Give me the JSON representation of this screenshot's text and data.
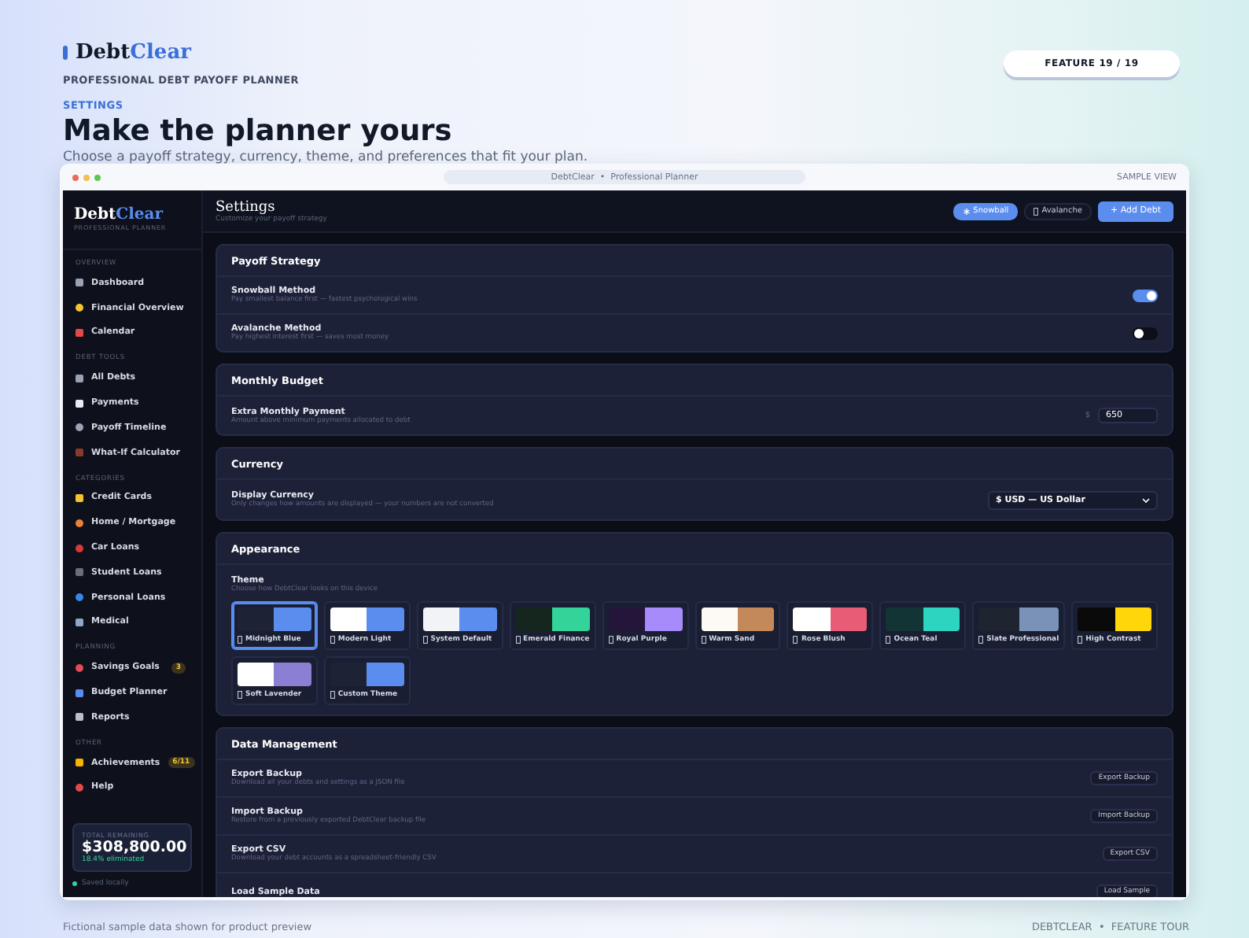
{
  "page": {
    "brand": {
      "name": "Debt",
      "accent": "Clear"
    },
    "tagline": "PROFESSIONAL DEBT PAYOFF PLANNER",
    "eyebrow": "SETTINGS",
    "heading": "Make the planner yours",
    "description": "Choose a payoff strategy, currency, theme, and preferences that fit your plan.",
    "feature_badge": "FEATURE 19 / 19",
    "footer_note": "Fictional sample data shown for product preview",
    "footer_right": "DEBTCLEAR  •  FEATURE TOUR"
  },
  "window": {
    "title": "DebtClear  •  Professional Planner",
    "label": "SAMPLE VIEW"
  },
  "sidebar": {
    "brand": {
      "name": "Debt",
      "accent": "Clear"
    },
    "subtitle": "PROFESSIONAL PLANNER",
    "sections": [
      {
        "title": "OVERVIEW",
        "items": [
          {
            "label": "Dashboard"
          },
          {
            "label": "Financial Overview"
          },
          {
            "label": "Calendar"
          }
        ]
      },
      {
        "title": "DEBT TOOLS",
        "items": [
          {
            "label": "All Debts"
          },
          {
            "label": "Payments"
          },
          {
            "label": "Payoff Timeline"
          },
          {
            "label": "What-If Calculator"
          }
        ]
      },
      {
        "title": "CATEGORIES",
        "items": [
          {
            "label": "Credit Cards"
          },
          {
            "label": "Home / Mortgage"
          },
          {
            "label": "Car Loans"
          },
          {
            "label": "Student Loans"
          },
          {
            "label": "Personal Loans"
          },
          {
            "label": "Medical"
          }
        ]
      },
      {
        "title": "PLANNING",
        "items": [
          {
            "label": "Savings Goals",
            "badge": "3"
          },
          {
            "label": "Budget Planner"
          },
          {
            "label": "Reports"
          }
        ]
      },
      {
        "title": "OTHER",
        "items": [
          {
            "label": "Achievements",
            "badge": "6/11"
          },
          {
            "label": "Help"
          }
        ]
      }
    ],
    "summary": {
      "label": "TOTAL REMAINING",
      "amount": "$308,800.00",
      "progress": "18.4% eliminated"
    },
    "status": "Saved locally"
  },
  "header": {
    "title": "Settings",
    "subtitle": "Customize your payoff strategy",
    "buttons": [
      {
        "label": "Snowball",
        "selected": true
      },
      {
        "label": "Avalanche",
        "selected": false
      }
    ],
    "primary_button": "+ Add Debt"
  },
  "sections": [
    {
      "title": "Payoff Strategy",
      "rows": [
        {
          "kind": "toggle",
          "label": "Snowball Method",
          "description": "Pay smallest balance first — fastest psychological wins",
          "on": true
        },
        {
          "kind": "toggle",
          "label": "Avalanche Method",
          "description": "Pay highest interest first — saves most money",
          "on": false
        }
      ]
    },
    {
      "title": "Monthly Budget",
      "rows": [
        {
          "kind": "amount",
          "label": "Extra Monthly Payment",
          "description": "Amount above minimum payments allocated to debt",
          "prefix": "$",
          "value": "650"
        }
      ]
    },
    {
      "title": "Currency",
      "rows": [
        {
          "kind": "select",
          "label": "Display Currency",
          "description": "Only changes how amounts are displayed — your numbers are not converted",
          "value": "$ USD — US Dollar"
        }
      ]
    },
    {
      "title": "Appearance",
      "rows": [
        {
          "kind": "themes",
          "label": "Theme",
          "description": "Choose how DebtClear looks on this device",
          "themes": [
            {
              "name": "Midnight Blue",
              "swatch": [
                {
                  "color": "#1e2235"
                },
                {
                  "color": "#5b8def"
                }
              ],
              "selected": true
            },
            {
              "name": "Modern Light",
              "swatch": [
                {
                  "color": "#ffffff"
                },
                {
                  "color": "#5b8def"
                }
              ],
              "selected": false
            },
            {
              "name": "System Default",
              "swatch": [
                {
                  "color": "#f1f3f7"
                },
                {
                  "color": "#5b8def"
                }
              ],
              "selected": false
            },
            {
              "name": "Emerald Finance",
              "swatch": [
                {
                  "color": "#14261e"
                },
                {
                  "color": "#34d399"
                }
              ],
              "selected": false
            },
            {
              "name": "Royal Purple",
              "swatch": [
                {
                  "color": "#24163a"
                },
                {
                  "color": "#a78bfa"
                }
              ],
              "selected": false
            },
            {
              "name": "Warm Sand",
              "swatch": [
                {
                  "color": "#fdfaf5"
                },
                {
                  "color": "#c4895a"
                }
              ],
              "selected": false
            },
            {
              "name": "Rose Blush",
              "swatch": [
                {
                  "color": "#ffffff"
                },
                {
                  "color": "#e85d75"
                }
              ],
              "selected": false
            },
            {
              "name": "Ocean Teal",
              "swatch": [
                {
                  "color": "#123434"
                },
                {
                  "color": "#2dd4bf"
                }
              ],
              "selected": false
            },
            {
              "name": "Slate Professional",
              "swatch": [
                {
                  "color": "#1e2430"
                },
                {
                  "color": "#7a92b8"
                }
              ],
              "selected": false
            },
            {
              "name": "High Contrast",
              "swatch": [
                {
                  "color": "#0a0a0a"
                },
                {
                  "color": "#ffd60a"
                }
              ],
              "selected": false
            },
            {
              "name": "Soft Lavender",
              "swatch": [
                {
                  "color": "#ffffff"
                },
                {
                  "color": "#8b7fd4"
                }
              ],
              "selected": false
            },
            {
              "name": "Custom Theme",
              "swatch": [
                {
                  "color": "#1e2235"
                },
                {
                  "color": "#5b8def"
                }
              ],
              "selected": false
            }
          ]
        }
      ]
    },
    {
      "title": "Data Management",
      "rows": [
        {
          "kind": "button",
          "label": "Export Backup",
          "description": "Download all your debts and settings as a JSON file",
          "button": "Export Backup"
        },
        {
          "kind": "button",
          "label": "Import Backup",
          "description": "Restore from a previously exported DebtClear backup file",
          "button": "Import Backup"
        },
        {
          "kind": "button",
          "label": "Export CSV",
          "description": "Download your debt accounts as a spreadsheet-friendly CSV",
          "button": "Export CSV"
        },
        {
          "kind": "button",
          "label": "Load Sample Data",
          "button": "Load Sample"
        }
      ]
    }
  ]
}
